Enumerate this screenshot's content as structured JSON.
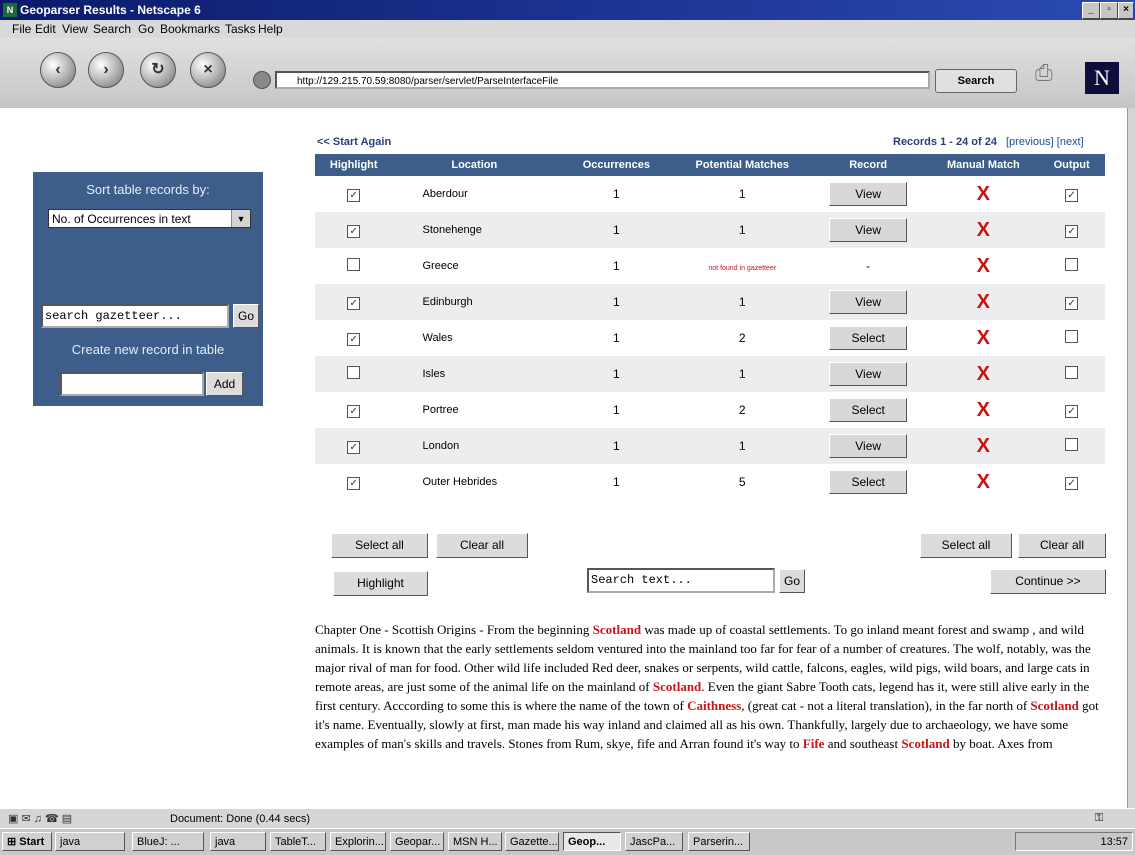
{
  "window": {
    "title": "Geoparser Results - Netscape 6"
  },
  "menu": [
    "File",
    "Edit",
    "View",
    "Search",
    "Go",
    "Bookmarks",
    "Tasks",
    "Help"
  ],
  "address": {
    "url": "http://129.215.70.59:8080/parser/servlet/ParseInterfaceFile",
    "search_label": "Search"
  },
  "sidebar": {
    "sort_label": "Sort table records by:",
    "sort_selected": "No. of Occurrences in text",
    "gazetteer_placeholder": "search gazetteer...",
    "go_label": "Go",
    "create_label": "Create new record in table",
    "add_label": "Add"
  },
  "results": {
    "start_again": "<< Start Again",
    "records_label": "Records 1 - 24 of 24",
    "prev_label": "[previous]",
    "next_label": "[next]",
    "headers": [
      "Highlight",
      "Location",
      "Occurrences",
      "Potential Matches",
      "Record",
      "Manual Match",
      "Output"
    ],
    "rows": [
      {
        "highlight": true,
        "location": "Aberdour",
        "occurrences": "1",
        "matches": "1",
        "record": "View",
        "output": true
      },
      {
        "highlight": true,
        "location": "Stonehenge",
        "occurrences": "1",
        "matches": "1",
        "record": "View",
        "output": true
      },
      {
        "highlight": false,
        "location": "Greece",
        "occurrences": "1",
        "matches": "not found in gazetteer",
        "record": "-",
        "output": false
      },
      {
        "highlight": true,
        "location": "Edinburgh",
        "occurrences": "1",
        "matches": "1",
        "record": "View",
        "output": true
      },
      {
        "highlight": true,
        "location": "Wales",
        "occurrences": "1",
        "matches": "2",
        "record": "Select",
        "output": false
      },
      {
        "highlight": false,
        "location": "Isles",
        "occurrences": "1",
        "matches": "1",
        "record": "View",
        "output": false
      },
      {
        "highlight": true,
        "location": "Portree",
        "occurrences": "1",
        "matches": "2",
        "record": "Select",
        "output": true
      },
      {
        "highlight": true,
        "location": "London",
        "occurrences": "1",
        "matches": "1",
        "record": "View",
        "output": false
      },
      {
        "highlight": true,
        "location": "Outer Hebrides",
        "occurrences": "1",
        "matches": "5",
        "record": "Select",
        "output": true
      }
    ],
    "manual_match_symbol": "X",
    "select_all": "Select all",
    "clear_all": "Clear all",
    "highlight_btn": "Highlight",
    "search_text_placeholder": "Search text...",
    "search_go": "Go",
    "continue_btn": "Continue >>"
  },
  "text": {
    "segments": [
      {
        "t": "Chapter One - Scottish Origins - From the beginning "
      },
      {
        "t": "Scotland",
        "h": true
      },
      {
        "t": " was made up of coastal settlements. To go inland meant forest and swamp , and wild animals. It is known that the early settlements seldom ventured into the mainland too far for fear of a number of creatures. The wolf, notably, was the major rival of man for food. Other wild life included Red deer, snakes or serpents, wild cattle, falcons, eagles, wild pigs, wild boars, and large cats in remote areas, are just some of the animal life on the mainland of "
      },
      {
        "t": "Scotland",
        "h": true
      },
      {
        "t": ". Even the giant Sabre Tooth cats, legend has it, were still alive early in the first century. Acccording to some this is where the name of the town of "
      },
      {
        "t": "Caithness",
        "h": true
      },
      {
        "t": ", (great cat - not a literal translation), in the far north of "
      },
      {
        "t": "Scotland",
        "h": true
      },
      {
        "t": " got it's name. Eventually, slowly at first, man made his way inland and claimed all as his own. Thankfully, largely due to archaeology, we have some examples of man's skills and travels. Stones from Rum, skye, fife and Arran found it's way to "
      },
      {
        "t": "Fife",
        "h": true
      },
      {
        "t": " and southeast "
      },
      {
        "t": "Scotland",
        "h": true
      },
      {
        "t": " by boat. Axes from"
      }
    ]
  },
  "status": {
    "text": "Document: Done (0.44 secs)"
  },
  "taskbar": {
    "start": "Start",
    "items": [
      "java",
      "BlueJ: ...",
      "java",
      "TableT...",
      "Explorin...",
      "Geopar...",
      "MSN H...",
      "Gazette...",
      "Geop...",
      "JascPa...",
      "Parserin..."
    ],
    "active_index": 8,
    "clock": "13:57"
  },
  "colors": {
    "header": "#3d5e8b",
    "highlight_text": "#c8141a",
    "manual_x": "#d01010"
  }
}
